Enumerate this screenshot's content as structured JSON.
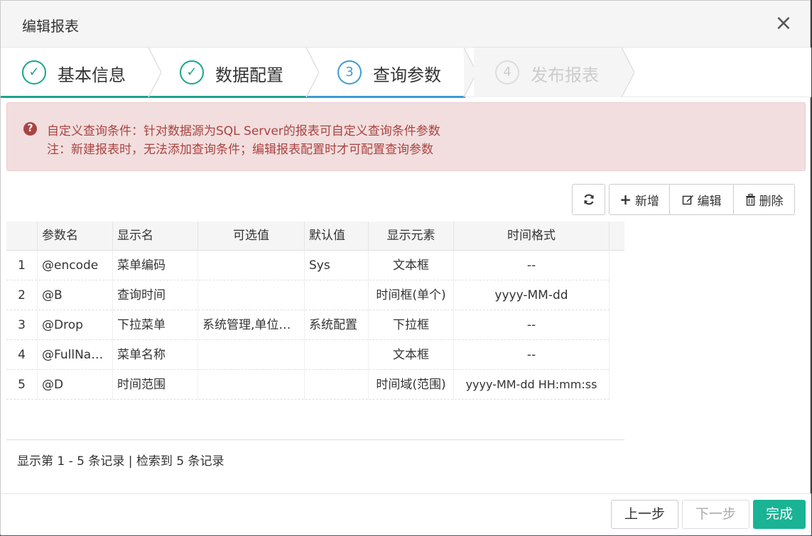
{
  "dialog": {
    "title": "编辑报表",
    "close_glyph": "×"
  },
  "steps": [
    {
      "number": "✓",
      "label": "基本信息",
      "state": "done"
    },
    {
      "number": "✓",
      "label": "数据配置",
      "state": "done"
    },
    {
      "number": "3",
      "label": "查询参数",
      "state": "active"
    },
    {
      "number": "4",
      "label": "发布报表",
      "state": "todo"
    }
  ],
  "alert": {
    "icon_glyph": "?",
    "line1": "自定义查询条件：针对数据源为SQL Server的报表可自定义查询条件参数",
    "line2": "注：新建报表时，无法添加查询条件；编辑报表配置时才可配置查询参数"
  },
  "toolbar": {
    "refresh_icon": "refresh-icon",
    "add_label": "新增",
    "edit_label": "编辑",
    "delete_label": "删除"
  },
  "table": {
    "columns": [
      "参数名",
      "显示名",
      "可选值",
      "默认值",
      "显示元素",
      "时间格式"
    ],
    "rows": [
      {
        "idx": "1",
        "name": "@encode",
        "display": "菜单编码",
        "options": "",
        "default": "Sys",
        "element": "文本框",
        "format": "--"
      },
      {
        "idx": "2",
        "name": "@B",
        "display": "查询时间",
        "options": "",
        "default": "",
        "element": "时间框(单个)",
        "format": "yyyy-MM-dd"
      },
      {
        "idx": "3",
        "name": "@Drop",
        "display": "下拉菜单",
        "options": "系统管理,单位管理",
        "default": "系统配置",
        "element": "下拉框",
        "format": "--"
      },
      {
        "idx": "4",
        "name": "@FullName",
        "display": "菜单名称",
        "options": "",
        "default": "",
        "element": "文本框",
        "format": "--"
      },
      {
        "idx": "5",
        "name": "@D",
        "display": "时间范围",
        "options": "",
        "default": "",
        "element": "时间域(范围)",
        "format": "yyyy-MM-dd HH:mm:ss"
      }
    ],
    "pager": "显示第 1 - 5 条记录 | 检索到 5 条记录"
  },
  "footer": {
    "prev_label": "上一步",
    "next_label": "下一步",
    "finish_label": "完成"
  },
  "colors": {
    "accent": "#1ab394",
    "active_step": "#3c9bd6",
    "danger_text": "#a94442"
  }
}
